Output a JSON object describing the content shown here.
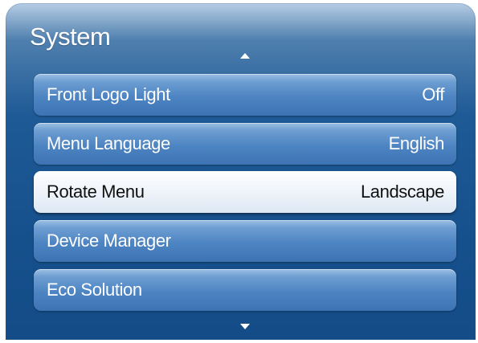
{
  "panel": {
    "title": "System"
  },
  "menu": {
    "items": [
      {
        "label": "Front Logo Light",
        "value": "Off"
      },
      {
        "label": "Menu Language",
        "value": "English"
      },
      {
        "label": "Rotate Menu",
        "value": "Landscape",
        "selected": true
      },
      {
        "label": "Device Manager",
        "value": ""
      },
      {
        "label": "Eco Solution",
        "value": ""
      }
    ]
  },
  "icons": {
    "scroll_up": "triangle-up-icon",
    "scroll_down": "triangle-down-icon"
  },
  "colors": {
    "panel_top": "#b6cde4",
    "panel_bottom": "#134c87",
    "item_bg": "#4d84c2",
    "item_selected_bg": "#f2f6fb",
    "item_text": "#ffffff",
    "item_selected_text": "#111111"
  }
}
